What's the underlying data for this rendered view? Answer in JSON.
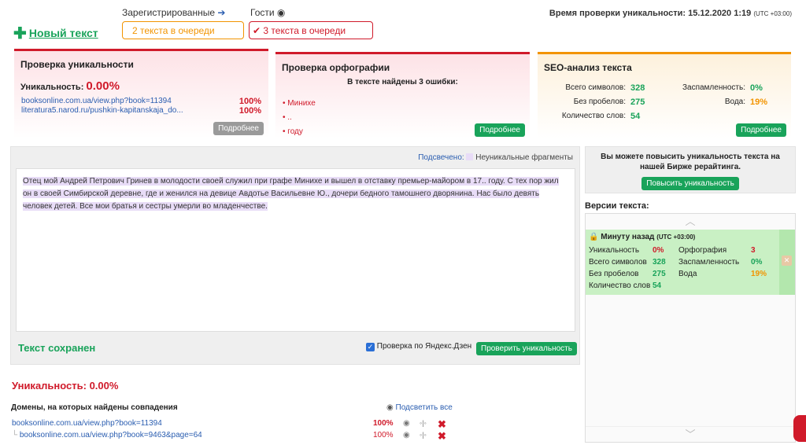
{
  "header": {
    "new_text": "Новый текст",
    "registered_label": "Зарегистрированные",
    "guests_label": "Гости",
    "registered_queue": "2 текста в очереди",
    "guests_queue": "3 текста в очереди",
    "check_time_label": "Время проверки уникальности: 15.12.2020 1:19",
    "check_time_tz": "(UTC +03:00)"
  },
  "uniqueness_panel": {
    "title": "Проверка уникальности",
    "label": "Уникальность:",
    "value": "0.00%",
    "links": [
      {
        "url": "booksonline.com.ua/view.php?book=11394",
        "pct": "100%"
      },
      {
        "url": "literatura5.narod.ru/pushkin-kapitanskaja_do...",
        "pct": "100%"
      }
    ],
    "more": "Подробнее"
  },
  "spelling_panel": {
    "title": "Проверка орфографии",
    "subtitle": "В тексте найдены 3 ошибки:",
    "errors": [
      "Минихе",
      "..",
      "году"
    ],
    "more": "Подробнее"
  },
  "seo_panel": {
    "title": "SEO-анализ текста",
    "chars_label": "Всего символов:",
    "chars": "328",
    "nospaces_label": "Без пробелов:",
    "nospaces": "275",
    "words_label": "Количество слов:",
    "words": "54",
    "spam_label": "Заспамленность:",
    "spam": "0%",
    "water_label": "Вода:",
    "water": "19%",
    "more": "Подробнее"
  },
  "editor": {
    "highlight_label": "Подсвечено:",
    "legend": "Неуникальные фрагменты",
    "text": "Отец мой Андрей Петрович Гринев в молодости своей служил при графе Минихе и вышел в отставку премьер-майором в 17.. году. С тех пор жил он в своей Симбирской деревне, где и женился на девице Авдотье Васильевне Ю., дочери бедного тамошнего дворянина. Нас было девять человек детей. Все мои братья и сестры умерли во младенчестве.",
    "saved": "Текст сохранен",
    "yandex_check": "Проверка по Яндекс.Дзен",
    "check_button": "Проверить уникальность"
  },
  "results": {
    "uniqueness": "Уникальность: 0.00%",
    "domains_title": "Домены, на которых найдены совпадения",
    "highlight_all": "Подсветить все",
    "rows": [
      {
        "url": "booksonline.com.ua/view.php?book=11394",
        "pct": "100%"
      },
      {
        "url": "booksonline.com.ua/view.php?book=9463&page=64",
        "pct": "100%"
      }
    ]
  },
  "sidebar": {
    "promo": "Вы можете повысить уникальность текста на нашей Бирже рерайтинга.",
    "promo_button": "Повысить уникальность",
    "versions_title": "Версии текста:",
    "version": {
      "time": "Минуту назад",
      "tz": "(UTC +03:00)",
      "uniq_label": "Уникальность",
      "uniq": "0%",
      "chars_label": "Всего символов",
      "chars": "328",
      "nospaces_label": "Без пробелов",
      "nospaces": "275",
      "words_label": "Количество слов",
      "words": "54",
      "spell_label": "Орфография",
      "spell": "3",
      "spam_label": "Заспамленность",
      "spam": "0%",
      "water_label": "Вода",
      "water": "19%"
    }
  },
  "colors": {
    "accent_green": "#19a35a",
    "accent_red": "#d01a2a",
    "accent_orange": "#f29400"
  }
}
